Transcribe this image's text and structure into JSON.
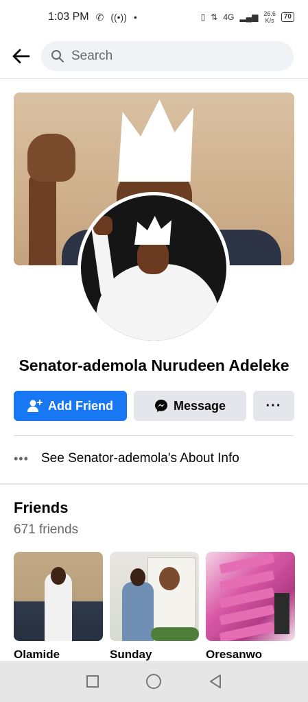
{
  "status_bar": {
    "time": "1:03 PM",
    "network": "4G",
    "speed_value": "26.6",
    "speed_unit": "K/s",
    "battery": "70"
  },
  "top_nav": {
    "back_icon": "arrow-left-icon",
    "search_placeholder": "Search"
  },
  "profile": {
    "name": "Senator-ademola Nurudeen Adeleke",
    "add_friend_label": "Add Friend",
    "message_label": "Message",
    "more_label": "···",
    "about_label": "See Senator-ademola's About Info"
  },
  "friends": {
    "title": "Friends",
    "count": "671 friends",
    "items": [
      {
        "name": "Olamide"
      },
      {
        "name": "Sunday"
      },
      {
        "name": "Oresanwo"
      }
    ]
  },
  "colors": {
    "accent": "#1877f2",
    "button_gray": "#e4e6eb",
    "secondary_text": "#65676b"
  }
}
